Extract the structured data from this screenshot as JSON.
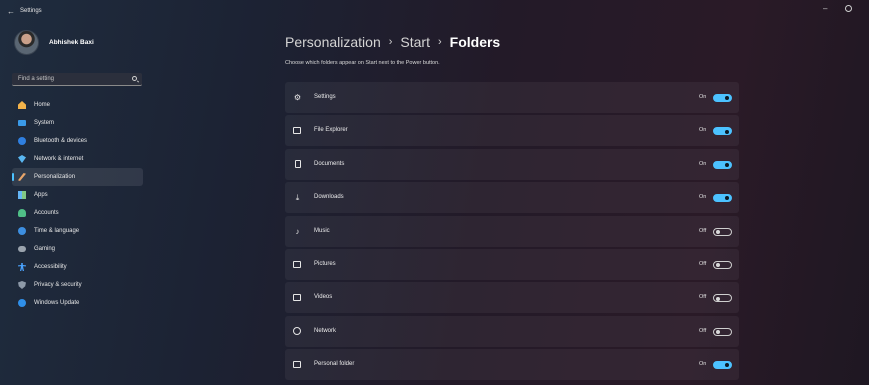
{
  "app": {
    "back_glyph": "←",
    "title": "Settings",
    "minimize_glyph": "–"
  },
  "user": {
    "name": "Abhishek Baxi"
  },
  "search": {
    "placeholder": "Find a setting"
  },
  "sidebar": {
    "items": [
      {
        "label": "Home",
        "icon": "home-icon"
      },
      {
        "label": "System",
        "icon": "system-icon"
      },
      {
        "label": "Bluetooth & devices",
        "icon": "bluetooth-icon"
      },
      {
        "label": "Network & internet",
        "icon": "network-icon"
      },
      {
        "label": "Personalization",
        "icon": "personalization-icon",
        "active": true
      },
      {
        "label": "Apps",
        "icon": "apps-icon"
      },
      {
        "label": "Accounts",
        "icon": "accounts-icon"
      },
      {
        "label": "Time & language",
        "icon": "time-language-icon"
      },
      {
        "label": "Gaming",
        "icon": "gaming-icon"
      },
      {
        "label": "Accessibility",
        "icon": "accessibility-icon"
      },
      {
        "label": "Privacy & security",
        "icon": "privacy-icon"
      },
      {
        "label": "Windows Update",
        "icon": "windows-update-icon"
      }
    ]
  },
  "main": {
    "breadcrumb": [
      "Personalization",
      "Start",
      "Folders"
    ],
    "separator": "›",
    "subtitle": "Choose which folders appear on Start next to the Power button.",
    "folders": [
      {
        "label": "Settings",
        "state": "On",
        "on": true,
        "icon": "gear-icon"
      },
      {
        "label": "File Explorer",
        "state": "On",
        "on": true,
        "icon": "file-explorer-icon"
      },
      {
        "label": "Documents",
        "state": "On",
        "on": true,
        "icon": "document-icon"
      },
      {
        "label": "Downloads",
        "state": "On",
        "on": true,
        "icon": "download-icon"
      },
      {
        "label": "Music",
        "state": "Off",
        "on": false,
        "icon": "music-icon"
      },
      {
        "label": "Pictures",
        "state": "Off",
        "on": false,
        "icon": "pictures-icon"
      },
      {
        "label": "Videos",
        "state": "Off",
        "on": false,
        "icon": "videos-icon"
      },
      {
        "label": "Network",
        "state": "Off",
        "on": false,
        "icon": "network-globe-icon"
      },
      {
        "label": "Personal folder",
        "state": "On",
        "on": true,
        "icon": "personal-folder-icon"
      }
    ]
  },
  "colors": {
    "accent": "#4cc2ff"
  }
}
